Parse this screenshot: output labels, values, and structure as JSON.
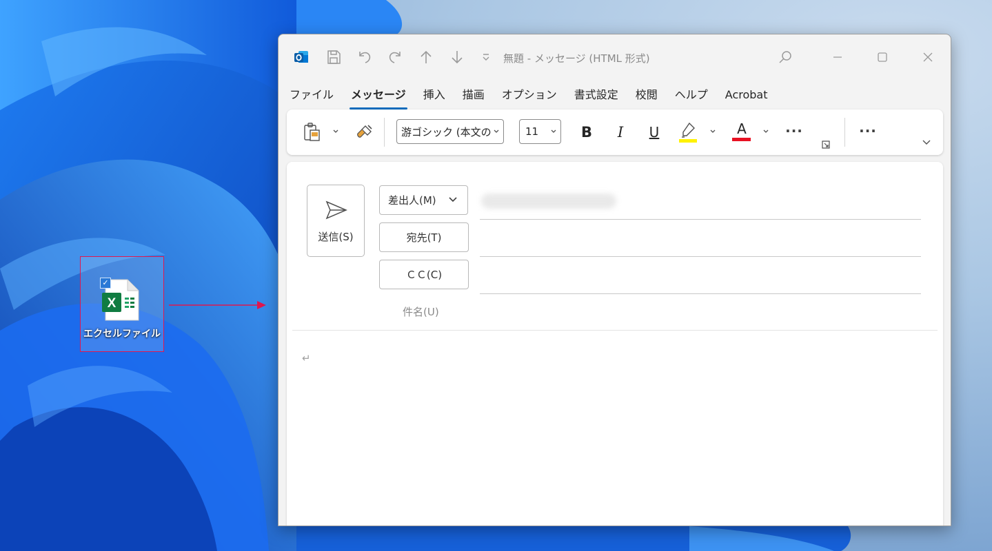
{
  "desktop": {
    "icon_label": "エクセルファイル",
    "icon_name": "excel-file-icon",
    "selected_check": "✓"
  },
  "window": {
    "title": "無題 - メッセージ (HTML 形式)",
    "app_icon": "outlook-icon"
  },
  "tabs": [
    "ファイル",
    "メッセージ",
    "挿入",
    "描画",
    "オプション",
    "書式設定",
    "校閲",
    "ヘルプ",
    "Acrobat"
  ],
  "active_tab": "メッセージ",
  "ribbon": {
    "font_name": "游ゴシック (本文の",
    "font_size": "11",
    "bold": "B",
    "italic": "I",
    "underline": "U",
    "font_color_glyph": "A",
    "more": "···",
    "highlight_color": "#fff200",
    "font_color": "#e81123"
  },
  "compose": {
    "send_label": "送信(S)",
    "from_label": "差出人(M)",
    "to_label": "宛先(T)",
    "cc_label": "ＣＣ(C)",
    "subject_label": "件名(U)",
    "paragraph_mark": "↵"
  },
  "colors": {
    "accent": "#0f6cbd",
    "highlight_border": "#e0174f"
  }
}
